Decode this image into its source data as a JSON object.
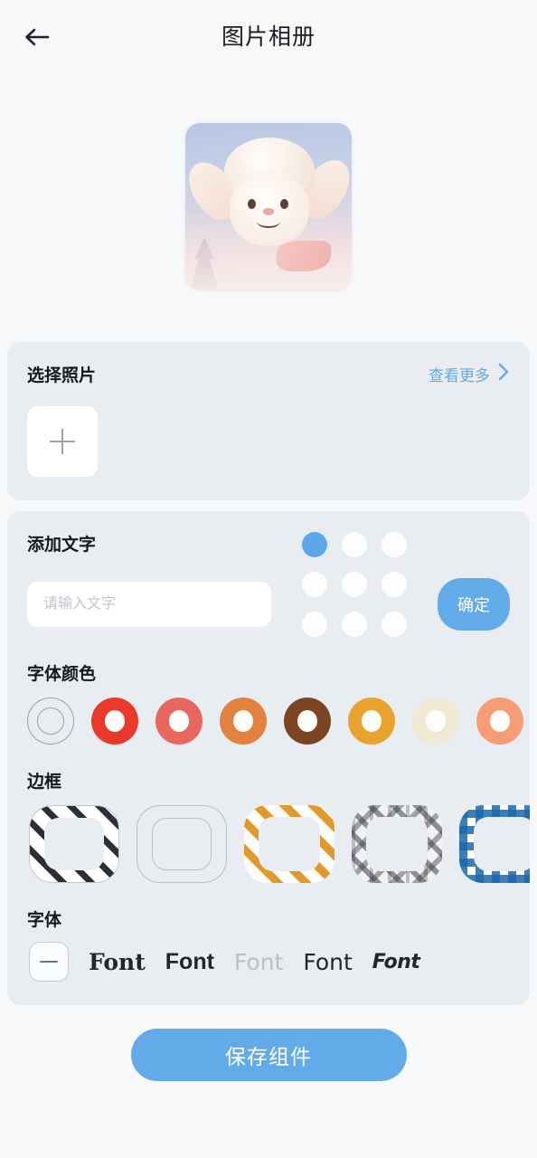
{
  "header": {
    "title": "图片相册",
    "back_icon": "arrow-left-icon"
  },
  "preview": {
    "alt": "白色羊驼玩偶照片预览"
  },
  "photos_section": {
    "title": "选择照片",
    "more_label": "查看更多",
    "more_icon": "chevron-right-icon",
    "add_icon": "plus-icon"
  },
  "text_section": {
    "title": "添加文字",
    "input_value": "",
    "input_placeholder": "请输入文字",
    "confirm_label": "确定",
    "position_grid": {
      "selected_index": 0,
      "cells": [
        {
          "index": 0,
          "selected": true
        },
        {
          "index": 1,
          "selected": false
        },
        {
          "index": 2,
          "selected": false
        },
        {
          "index": 3,
          "selected": false
        },
        {
          "index": 4,
          "selected": false
        },
        {
          "index": 5,
          "selected": false
        },
        {
          "index": 6,
          "selected": false
        },
        {
          "index": 7,
          "selected": false
        },
        {
          "index": 8,
          "selected": false
        }
      ],
      "active_color": "#5aa8e8",
      "inactive_color": "#fdfdfe"
    }
  },
  "font_color_section": {
    "title": "字体颜色",
    "swatches": [
      {
        "name": "none",
        "color": "none"
      },
      {
        "name": "red",
        "color": "#e8392a"
      },
      {
        "name": "salmon",
        "color": "#e8685f"
      },
      {
        "name": "orange",
        "color": "#e3813f"
      },
      {
        "name": "brown",
        "color": "#7b4422"
      },
      {
        "name": "amber",
        "color": "#e8a22e"
      },
      {
        "name": "cream",
        "color": "#f2e9d5"
      },
      {
        "name": "peach",
        "color": "#f79d76"
      },
      {
        "name": "yellow",
        "color": "#f5c015"
      }
    ]
  },
  "border_section": {
    "title": "边框",
    "frames": [
      {
        "name": "diagonal-stripe-black",
        "style": "stripe-bw"
      },
      {
        "name": "plain-outline",
        "style": "plain"
      },
      {
        "name": "diagonal-stripe-orange",
        "style": "stripe-or"
      },
      {
        "name": "plaid-gray",
        "style": "plaid-gray"
      },
      {
        "name": "gingham-blue",
        "style": "gingham"
      },
      {
        "name": "diagonal-stripe-gray",
        "style": "partial"
      }
    ]
  },
  "font_section": {
    "title": "字体",
    "none_icon": "minus-icon",
    "samples": [
      {
        "label": "Font",
        "style": "fs-1"
      },
      {
        "label": "Font",
        "style": "fs-2"
      },
      {
        "label": "Font",
        "style": "fs-3"
      },
      {
        "label": "Font",
        "style": "fs-4"
      },
      {
        "label": "Font",
        "style": "fs-5"
      }
    ]
  },
  "footer": {
    "save_label": "保存组件"
  },
  "colors": {
    "page_bg": "#f7f8f9",
    "card_bg": "#e9edf1",
    "accent": "#63aae8",
    "link": "#6aa9dd",
    "text": "#16181b"
  }
}
